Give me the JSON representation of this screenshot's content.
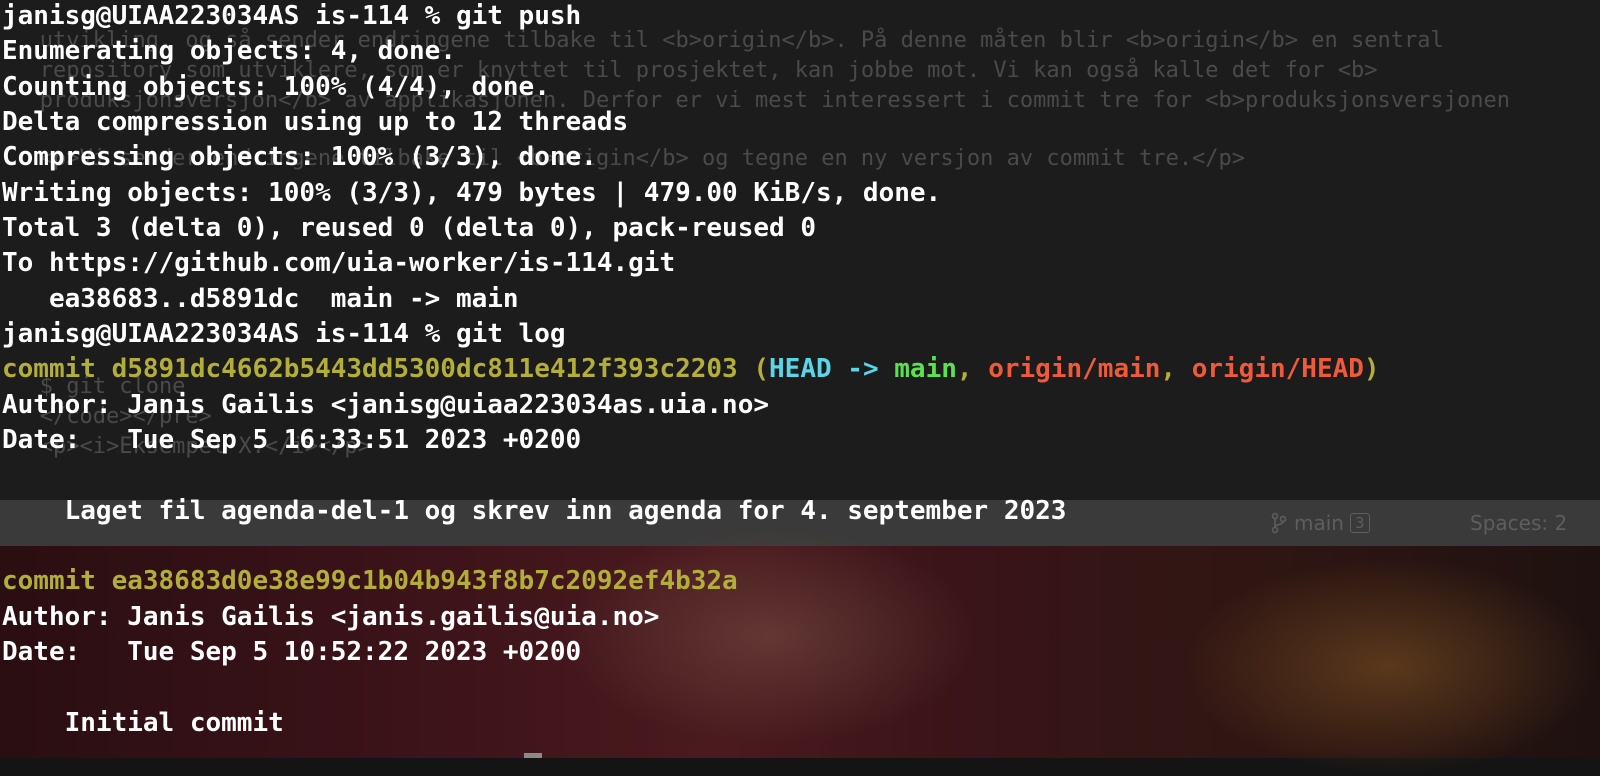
{
  "colors": {
    "terminal_text": "#ffffff",
    "commit_hash": "#b3ae3a",
    "head": "#5ad6e8",
    "branch_local": "#5ce24e",
    "branch_remote": "#ee5a3a",
    "status_bar": "#3a3a3a"
  },
  "terminal": {
    "push_prompt": "janisg@UIAA223034AS is-114 % git push",
    "push_output": [
      "Enumerating objects: 4, done.",
      "Counting objects: 100% (4/4), done.",
      "Delta compression using up to 12 threads",
      "Compressing objects: 100% (3/3), done.",
      "Writing objects: 100% (3/3), 479 bytes | 479.00 KiB/s, done.",
      "Total 3 (delta 0), reused 0 (delta 0), pack-reused 0",
      "To https://github.com/uia-worker/is-114.git",
      "   ea38683..d5891dc  main -> main"
    ],
    "log_prompt": "janisg@UIAA223034AS is-114 % git log",
    "commits": [
      {
        "hash_line": "commit d5891dc4662b5443dd5300dc811e412f393c2203",
        "refs": {
          "open": " (",
          "head": "HEAD",
          "arrow": " -> ",
          "branch": "main",
          "sep1": ", ",
          "remote1": "origin/main",
          "sep2": ", ",
          "remote2": "origin/HEAD",
          "close": ")"
        },
        "author": "Author: Janis Gailis <janisg@uiaa223034as.uia.no>",
        "date": "Date:   Tue Sep 5 16:33:51 2023 +0200",
        "message": "    Laget fil agenda-del-1 og skrev inn agenda for 4. september 2023"
      },
      {
        "hash_line": "commit ea38683d0e38e99c1b04b943f8b7c2092ef4b32a",
        "author": "Author: Janis Gailis <janis.gailis@uia.no>",
        "date": "Date:   Tue Sep 5 10:52:22 2023 +0200",
        "message": "    Initial commit"
      }
    ]
  },
  "background_editor": {
    "lines": [
      "   utvikling, og så sender endringene tilbake til <b>origin</b>. På denne måten blir <b>origin</b> en sentral",
      "   repository som utviklere, som er knyttet til prosjektet, kan jobbe mot. Vi kan også kalle det for <b>",
      "   produksjonsversjon</b> av applikasjonen. Derfor er vi mest interessert i commit tre for <b>produksjonsversjonen",
      "   <p>Vi sender endringene tilbake til <b>origin</b> og tegne en ny versjon av commit tre.</p>",
      "   $ git clone",
      "   </code></pre>",
      "   <p><i>Eksempel X.</i></p>"
    ],
    "status_branch": "main",
    "status_branch_count": "3",
    "status_spaces": "Spaces: 2",
    "branch_icon": "git-branch-icon"
  }
}
